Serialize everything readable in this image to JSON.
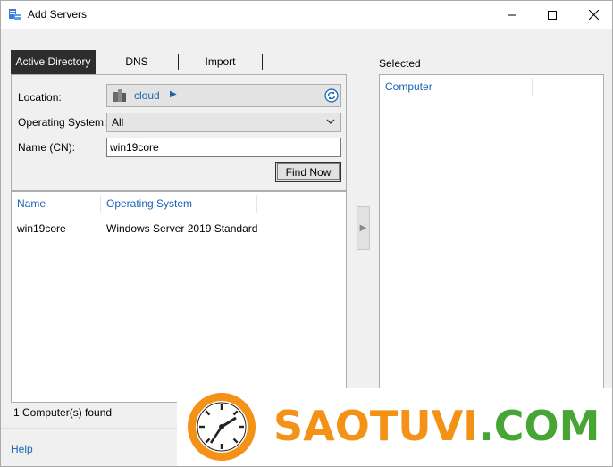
{
  "window": {
    "title": "Add Servers",
    "controls": {
      "minimize": "—",
      "maximize": "☐",
      "close": "✕"
    }
  },
  "tabs": [
    {
      "label": "Active Directory",
      "active": true
    },
    {
      "label": "DNS",
      "active": false
    },
    {
      "label": "Import",
      "active": false
    }
  ],
  "search": {
    "location_label": "Location:",
    "location_value": "cloud",
    "os_label": "Operating System:",
    "os_value": "All",
    "name_label": "Name (CN):",
    "name_value": "win19core",
    "find_button": "Find Now"
  },
  "results": {
    "columns": [
      "Name",
      "Operating System"
    ],
    "rows": [
      {
        "name": "win19core",
        "os": "Windows Server 2019 Standard"
      }
    ],
    "status": "1 Computer(s) found"
  },
  "selected": {
    "label": "Selected",
    "column": "Computer"
  },
  "footer": {
    "help": "Help"
  },
  "watermark": {
    "text_a": "SAOTUVI",
    "text_b": ".COM"
  },
  "colors": {
    "accent": "#1a64b4",
    "active_tab_bg": "#2d2d30",
    "watermark_orange": "#f39217",
    "watermark_green": "#46a535"
  },
  "icons": {
    "app": "server-manager-icon",
    "location": "domain-icon",
    "refresh": "refresh-icon",
    "dropdown": "chevron-down-icon",
    "move": "arrow-right-icon",
    "logo": "clock-logo-icon"
  }
}
